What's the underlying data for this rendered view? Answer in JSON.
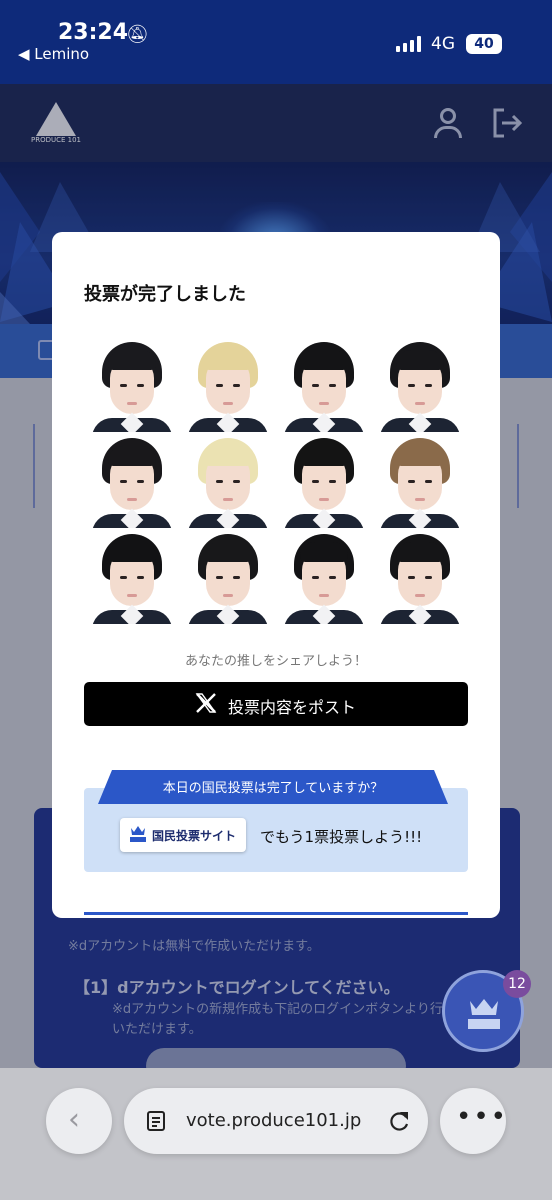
{
  "status_bar": {
    "time": "23:24",
    "back_app": "◀ Lemino",
    "network": "4G",
    "battery": "40"
  },
  "app_header": {
    "logo_text": "PRODUCE 101"
  },
  "modal": {
    "title": "投票が完了しました",
    "faces": [
      {
        "hair": "#1a1a1e"
      },
      {
        "hair": "#e4d39a"
      },
      {
        "hair": "#141416"
      },
      {
        "hair": "#17171a"
      },
      {
        "hair": "#19181b"
      },
      {
        "hair": "#ebe2b2"
      },
      {
        "hair": "#141414"
      },
      {
        "hair": "#8a6a4a"
      },
      {
        "hair": "#121214"
      },
      {
        "hair": "#18181a"
      },
      {
        "hair": "#131315"
      },
      {
        "hair": "#151517"
      }
    ],
    "share_text": "あなたの推しをシェアしよう！",
    "post_button": "投票内容をポスト",
    "national": {
      "ribbon": "本日の国民投票は完了していますか？",
      "button": "国民投票サイト",
      "after_text": "でもう1票投票しよう!!!"
    }
  },
  "background": {
    "line1": "※dアカウントは無料で作成いただけます。",
    "line2": "【1】dアカウントでログインしてください。",
    "line3": "※dアカウントの新規作成も下記のログインボタンより行っていただけます。",
    "fab_badge": "12"
  },
  "browser": {
    "url": "vote.produce101.jp",
    "back_glyph": "‹",
    "more_glyph": "•••"
  },
  "colors": {
    "header": "#172352",
    "accent": "#2b57c8",
    "post_button": "#000000"
  }
}
